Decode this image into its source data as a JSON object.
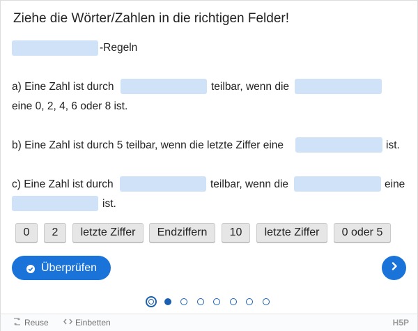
{
  "task": {
    "title": "Ziehe die Wörter/Zahlen in die richtigen Felder!"
  },
  "heading": {
    "suffix": "-Regeln"
  },
  "rule_a": {
    "part1": "a) Eine Zahl ist durch",
    "part2": "teilbar, wenn die",
    "part3": "eine 0, 2, 4, 6 oder 8 ist."
  },
  "rule_b": {
    "part1": "b) Eine Zahl ist durch 5 teilbar, wenn die letzte Ziffer eine",
    "part2": "ist."
  },
  "rule_c": {
    "part1": "c) Eine Zahl ist durch",
    "part2": "teilbar, wenn die",
    "part3": "eine",
    "part4": "ist."
  },
  "draggables": [
    "0",
    "2",
    "letzte Ziffer",
    "Endziffern",
    "10",
    "letzte Ziffer",
    "0 oder 5"
  ],
  "buttons": {
    "check": "Überprüfen"
  },
  "pagination": {
    "total": 8,
    "current": 1
  },
  "footer": {
    "reuse": "Reuse",
    "embed": "Einbetten",
    "brand": "H5P"
  },
  "colors": {
    "accent": "#1a73d9",
    "dropzone": "#cfe2f7",
    "chip_bg": "#e6e6e6"
  }
}
